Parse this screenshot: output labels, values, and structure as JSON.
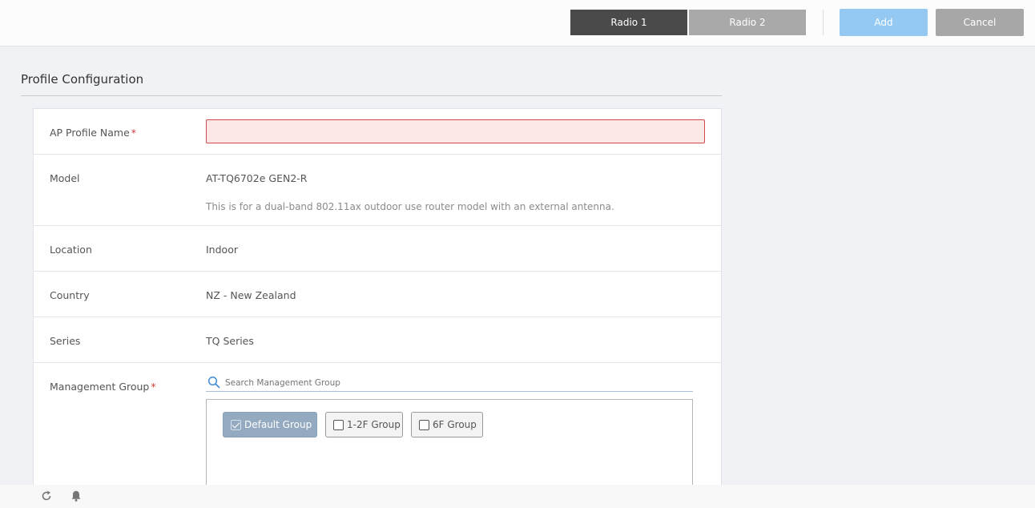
{
  "header": {
    "tabs": [
      {
        "label": "Radio 1",
        "active": true
      },
      {
        "label": "Radio 2",
        "active": false
      }
    ],
    "add_label": "Add",
    "cancel_label": "Cancel"
  },
  "section": {
    "title": "Profile Configuration"
  },
  "form": {
    "ap_profile_name": {
      "label": "AP Profile Name",
      "required_mark": "*",
      "value": ""
    },
    "model": {
      "label": "Model",
      "value": "AT-TQ6702e GEN2-R",
      "description": "This is for a dual-band 802.11ax outdoor use router model with an external antenna."
    },
    "location": {
      "label": "Location",
      "value": "Indoor"
    },
    "country": {
      "label": "Country",
      "value": "NZ - New Zealand"
    },
    "series": {
      "label": "Series",
      "value": "TQ Series"
    },
    "management_group": {
      "label": "Management Group",
      "required_mark": "*",
      "search_placeholder": "Search Management Group",
      "groups": [
        {
          "label": "Default Group",
          "checked": true
        },
        {
          "label": "1-2F Group",
          "checked": false
        },
        {
          "label": "6F Group",
          "checked": false
        }
      ]
    }
  },
  "colors": {
    "tab_active": "#4a4a4a",
    "tab_inactive": "#a9a9a9",
    "add_button": "#93c9f3",
    "cancel_button": "#a7a7a7",
    "error_border": "#d24b4b",
    "error_fill": "#fde8e8",
    "chip_selected": "#94aac0",
    "required_mark": "#d53b3b"
  },
  "footer": {
    "icons": [
      "refresh-icon",
      "bell-icon"
    ]
  }
}
